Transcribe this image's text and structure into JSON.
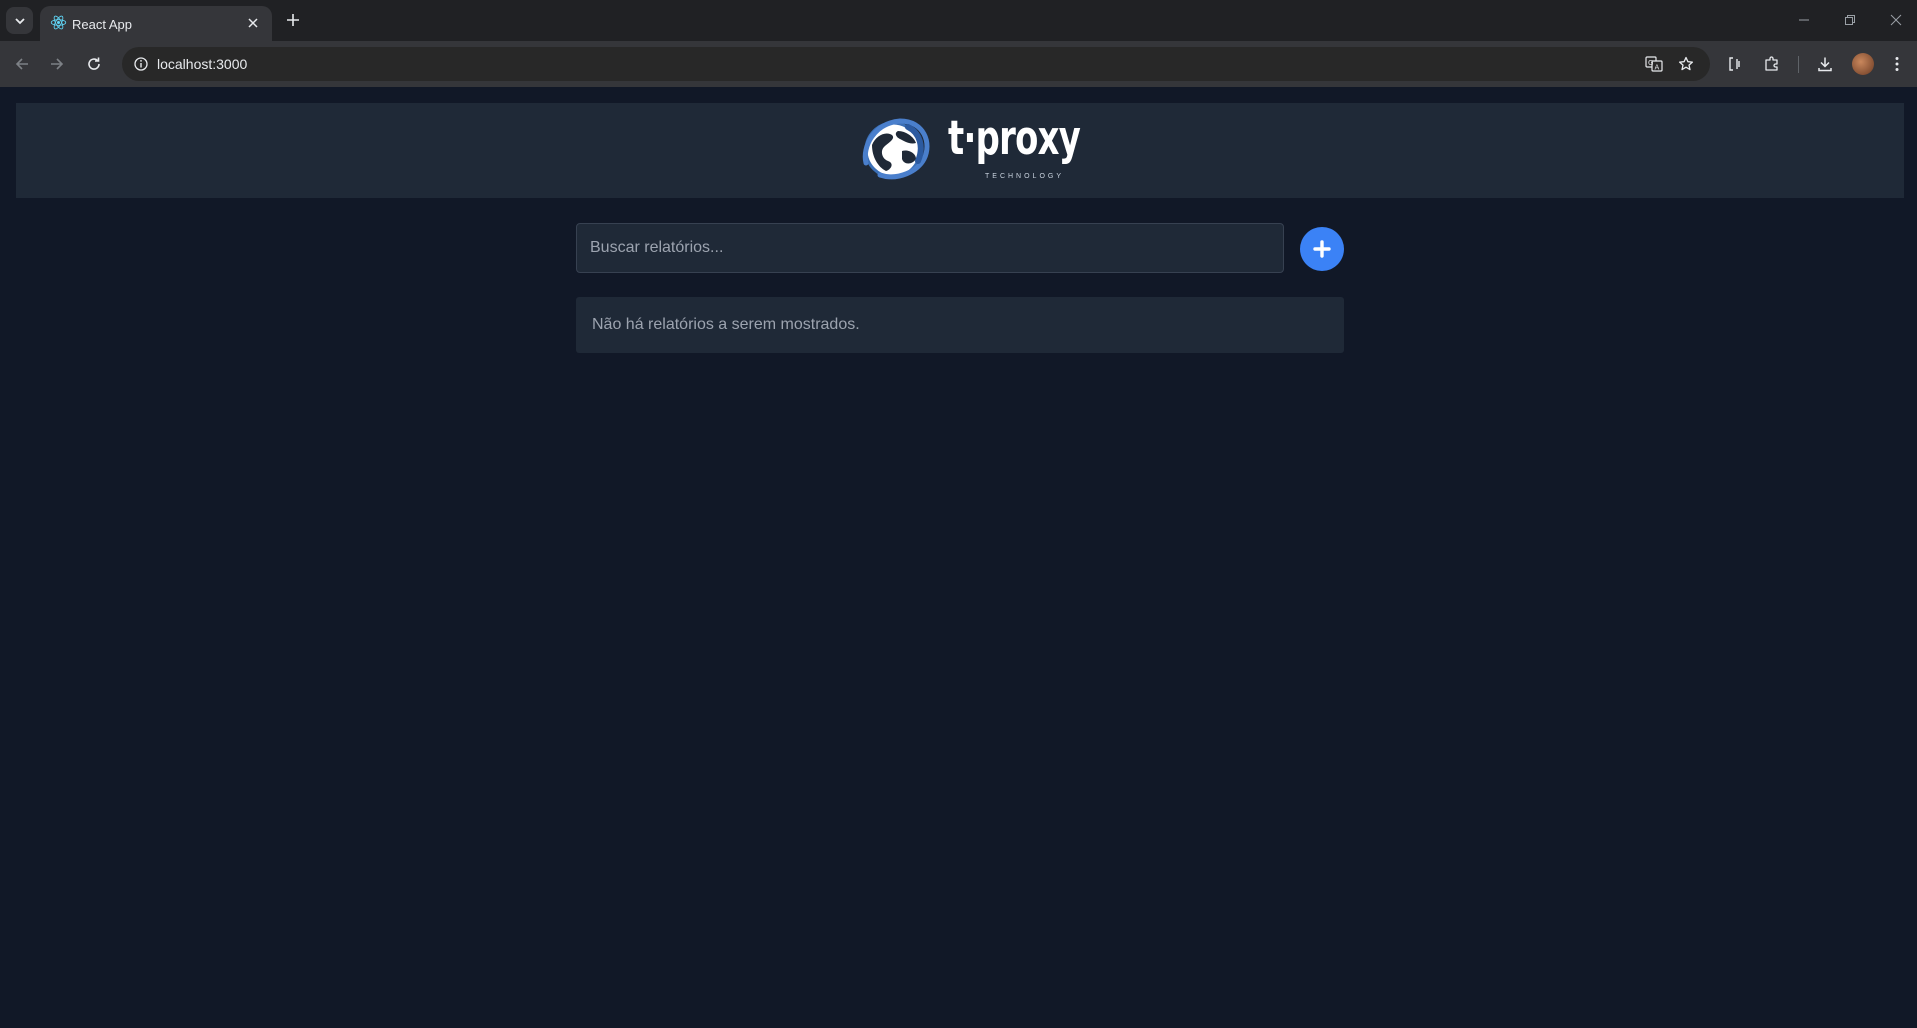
{
  "browser": {
    "tab_title": "React App",
    "url": "localhost:3000"
  },
  "header": {
    "logo_text": "t·proxy",
    "logo_tagline": "TECHNOLOGY"
  },
  "search": {
    "placeholder": "Buscar relatórios..."
  },
  "reports": {
    "empty_message": "Não há relatórios a serem mostrados."
  },
  "colors": {
    "page_background": "#111827",
    "panel_background": "#1f2937",
    "accent": "#3b82f6"
  },
  "icons": [
    "tab-search-icon",
    "react-favicon-icon",
    "close-icon",
    "plus-icon",
    "back-icon",
    "forward-icon",
    "reload-icon",
    "site-info-icon",
    "translate-icon",
    "star-icon",
    "extensions-icon",
    "download-icon",
    "more-menu-icon",
    "globe-logo-icon",
    "add-icon"
  ]
}
